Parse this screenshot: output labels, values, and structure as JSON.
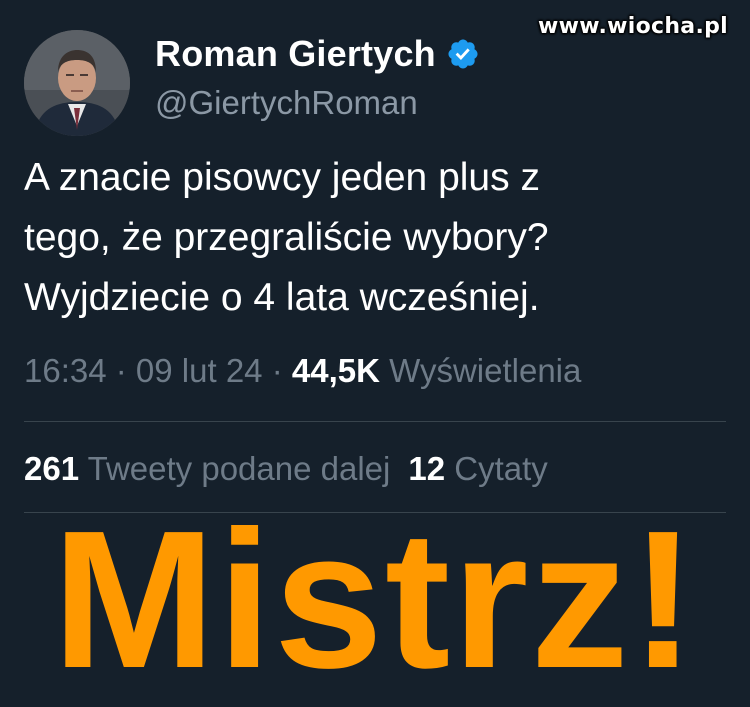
{
  "watermark": "www.wiocha.pl",
  "profile": {
    "display_name": "Roman Giertych",
    "handle": "@GiertychRoman",
    "verified_icon": "verified-badge-icon",
    "badge_color": "#1d9bf0"
  },
  "tweet": {
    "lines": [
      "A znacie pisowcy jeden plus z",
      "tego, że przegraliście wybory?",
      "Wyjdziecie o 4 lata wcześniej."
    ]
  },
  "meta": {
    "time": "16:34",
    "separator": " · ",
    "date": "09 lut 24",
    "views_count": "44,5K",
    "views_label": "Wyświetlenia"
  },
  "stats": {
    "retweets_count": "261",
    "retweets_label": "Tweety podane dalej",
    "quotes_count": "12",
    "quotes_label": "Cytaty"
  },
  "caption": "Mistrz!",
  "colors": {
    "background": "#15202b",
    "caption": "#ff9900",
    "muted_text": "#6e7b88",
    "divider": "#38444d"
  }
}
